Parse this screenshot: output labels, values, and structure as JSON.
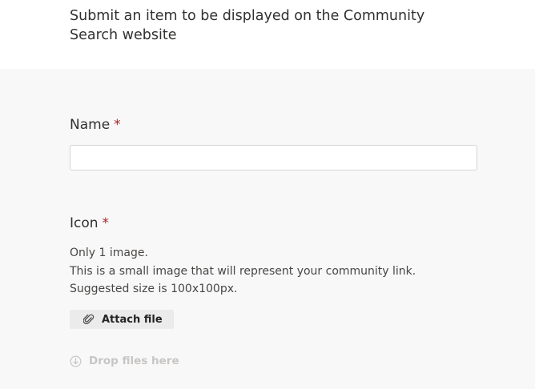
{
  "header": {
    "description": "Submit an item to be displayed on the Community Search website"
  },
  "form": {
    "name_field": {
      "label": "Name",
      "required_mark": "*",
      "value": "",
      "placeholder": ""
    },
    "icon_field": {
      "label": "Icon",
      "required_mark": "*",
      "description_lines": [
        "Only 1 image.",
        "This is a small image that will represent your community link.",
        "Suggested size is 100x100px."
      ],
      "attach_button_label": "Attach file",
      "attach_icon": "paperclip-icon",
      "drop_label": "Drop files here",
      "drop_icon": "download-circle-icon"
    }
  },
  "colors": {
    "required": "#a4262c",
    "form_background": "#f8f8f8",
    "button_background": "#ebebeb",
    "drop_text": "#c8c6c4"
  }
}
